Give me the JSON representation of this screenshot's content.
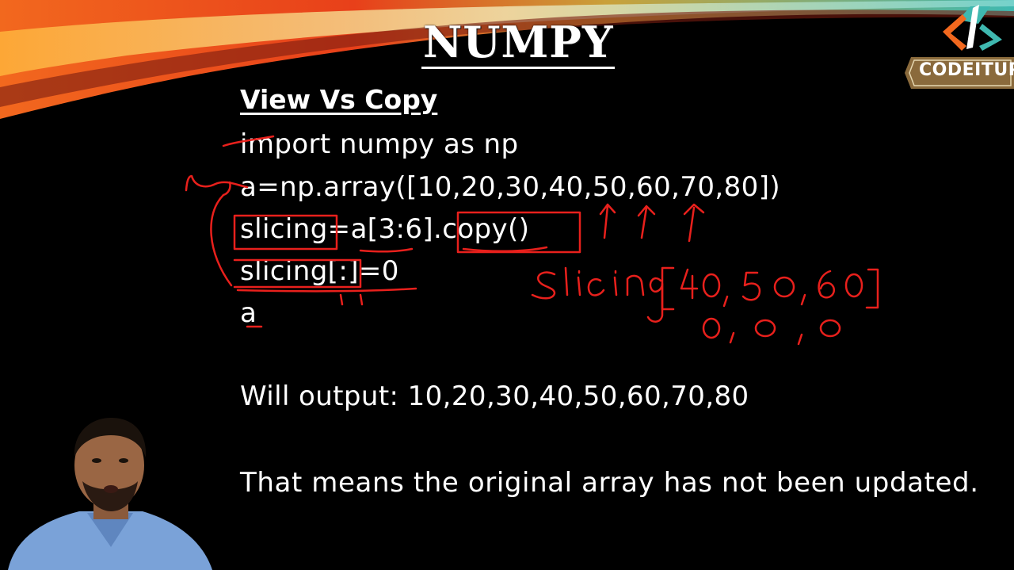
{
  "slide": {
    "title": "NUMPY",
    "subtitle": "View Vs Copy",
    "code_lines": [
      "import numpy as np",
      "a=np.array([10,20,30,40,50,60,70,80])",
      "slicing=a[3:6].copy()",
      "slicing[:]=0",
      "a"
    ],
    "output_text": "Will output: 10,20,30,40,50,60,70,80",
    "conclusion_text": "That means the original array has not been updated."
  },
  "annotations": {
    "handwritten_label": "Slicing",
    "values_row": "40, 50, 60",
    "zeros_row": "0, 0, 0",
    "ink_color": "#e8201c"
  },
  "brand": {
    "logo_text": "CODEITUP",
    "logo_bg": "#8a6a3c",
    "logo_icon": "code-bracket-logo-icon"
  },
  "colors": {
    "background": "#000000",
    "text": "#ffffff",
    "banner_orange": "#e8561a",
    "banner_teal": "#3fb8b0"
  },
  "presenter": {
    "icon": "presenter-webcam-icon"
  }
}
